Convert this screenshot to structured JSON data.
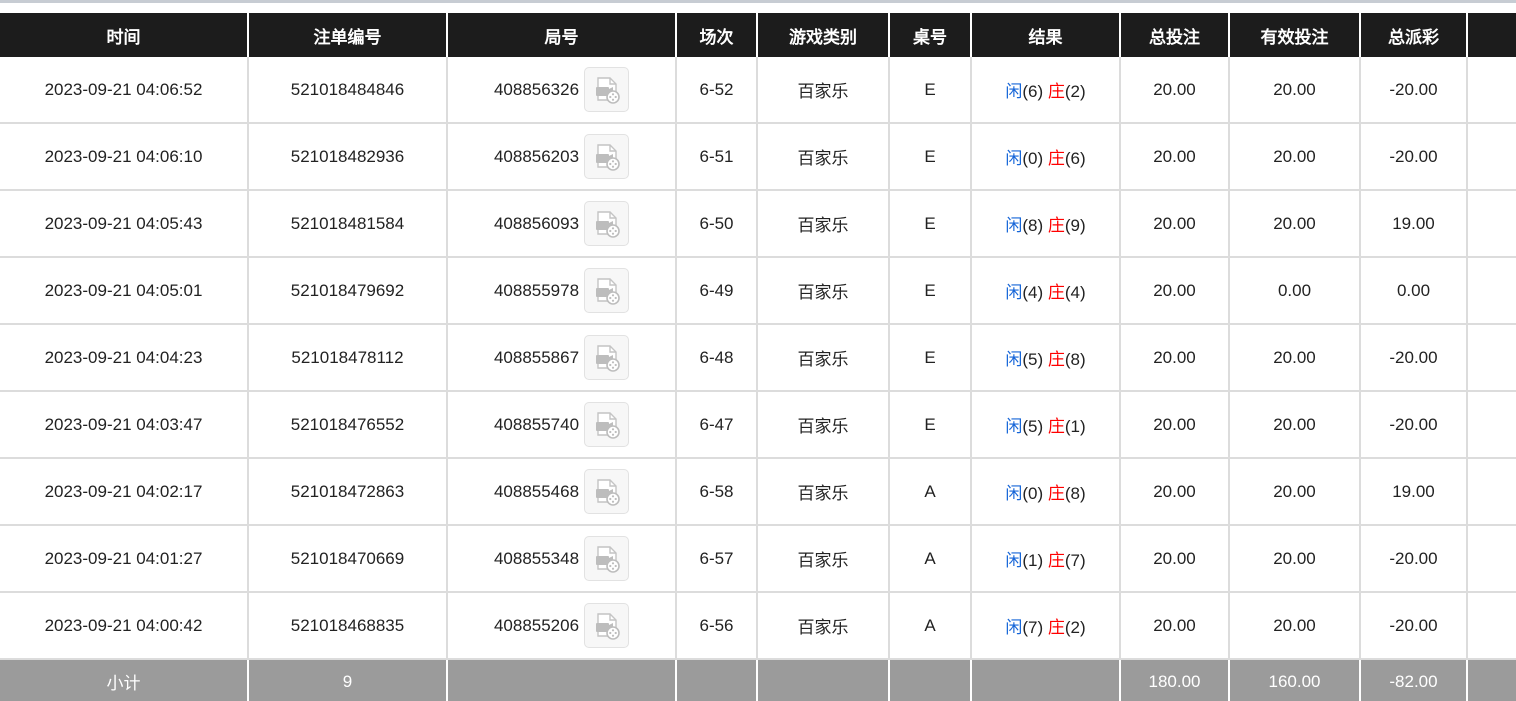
{
  "columns": [
    "时间",
    "注单编号",
    "局号",
    "场次",
    "游戏类别",
    "桌号",
    "结果",
    "总投注",
    "有效投注",
    "总派彩"
  ],
  "result_labels": {
    "player": "闲",
    "banker": "庄"
  },
  "icons": {
    "replay": "video-replay-icon"
  },
  "colors": {
    "header_bg": "#1c1c1c",
    "footer_bg": "#9b9b9b",
    "blue": "#1565d8",
    "red": "#ff0000"
  },
  "rows": [
    {
      "time": "2023-09-21 04:06:52",
      "bet_id": "521018484846",
      "round_id": "408856326",
      "session": "6-52",
      "game_type": "百家乐",
      "table": "E",
      "player": "(6)",
      "banker": "(2)",
      "total_bet": "20.00",
      "valid_bet": "20.00",
      "payout": "-20.00"
    },
    {
      "time": "2023-09-21 04:06:10",
      "bet_id": "521018482936",
      "round_id": "408856203",
      "session": "6-51",
      "game_type": "百家乐",
      "table": "E",
      "player": "(0)",
      "banker": "(6)",
      "total_bet": "20.00",
      "valid_bet": "20.00",
      "payout": "-20.00"
    },
    {
      "time": "2023-09-21 04:05:43",
      "bet_id": "521018481584",
      "round_id": "408856093",
      "session": "6-50",
      "game_type": "百家乐",
      "table": "E",
      "player": "(8)",
      "banker": "(9)",
      "total_bet": "20.00",
      "valid_bet": "20.00",
      "payout": "19.00"
    },
    {
      "time": "2023-09-21 04:05:01",
      "bet_id": "521018479692",
      "round_id": "408855978",
      "session": "6-49",
      "game_type": "百家乐",
      "table": "E",
      "player": "(4)",
      "banker": "(4)",
      "total_bet": "20.00",
      "valid_bet": "0.00",
      "payout": "0.00"
    },
    {
      "time": "2023-09-21 04:04:23",
      "bet_id": "521018478112",
      "round_id": "408855867",
      "session": "6-48",
      "game_type": "百家乐",
      "table": "E",
      "player": "(5)",
      "banker": "(8)",
      "total_bet": "20.00",
      "valid_bet": "20.00",
      "payout": "-20.00"
    },
    {
      "time": "2023-09-21 04:03:47",
      "bet_id": "521018476552",
      "round_id": "408855740",
      "session": "6-47",
      "game_type": "百家乐",
      "table": "E",
      "player": "(5)",
      "banker": "(1)",
      "total_bet": "20.00",
      "valid_bet": "20.00",
      "payout": "-20.00"
    },
    {
      "time": "2023-09-21 04:02:17",
      "bet_id": "521018472863",
      "round_id": "408855468",
      "session": "6-58",
      "game_type": "百家乐",
      "table": "A",
      "player": "(0)",
      "banker": "(8)",
      "total_bet": "20.00",
      "valid_bet": "20.00",
      "payout": "19.00"
    },
    {
      "time": "2023-09-21 04:01:27",
      "bet_id": "521018470669",
      "round_id": "408855348",
      "session": "6-57",
      "game_type": "百家乐",
      "table": "A",
      "player": "(1)",
      "banker": "(7)",
      "total_bet": "20.00",
      "valid_bet": "20.00",
      "payout": "-20.00"
    },
    {
      "time": "2023-09-21 04:00:42",
      "bet_id": "521018468835",
      "round_id": "408855206",
      "session": "6-56",
      "game_type": "百家乐",
      "table": "A",
      "player": "(7)",
      "banker": "(2)",
      "total_bet": "20.00",
      "valid_bet": "20.00",
      "payout": "-20.00"
    }
  ],
  "subtotal": {
    "label": "小计",
    "count": "9",
    "total_bet": "180.00",
    "valid_bet": "160.00",
    "payout": "-82.00"
  }
}
